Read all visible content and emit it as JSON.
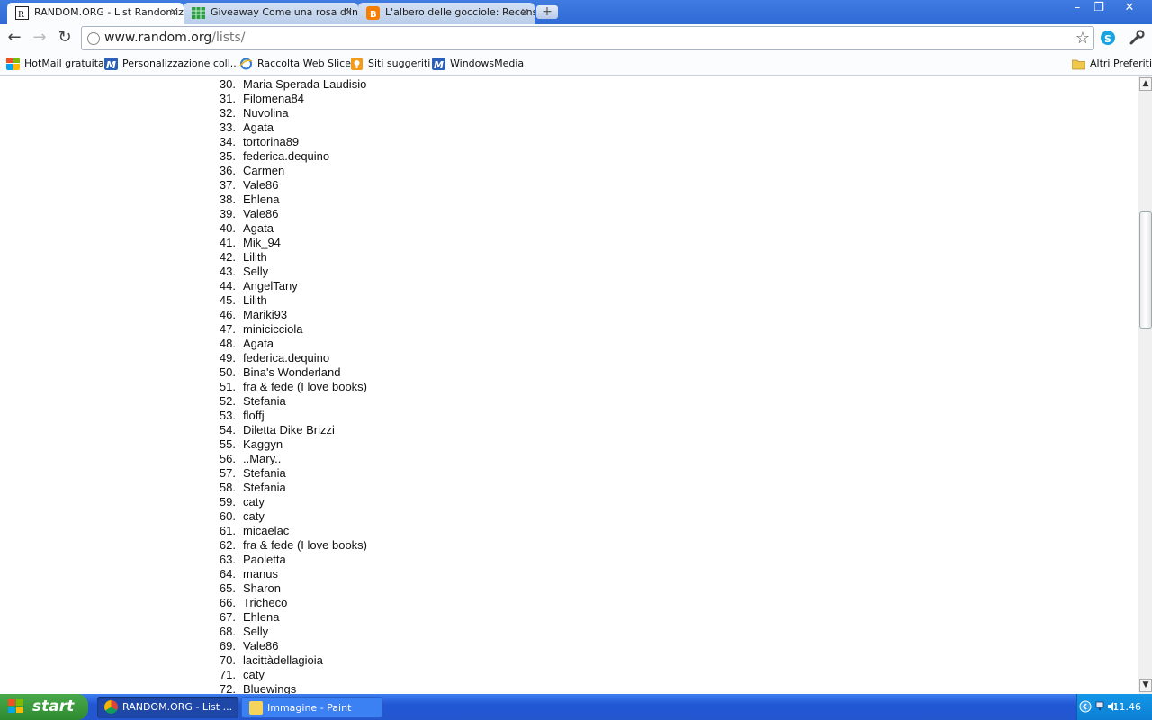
{
  "browser": {
    "tabs": [
      {
        "title": "RANDOM.ORG - List Randomiz",
        "active": true
      },
      {
        "title": "Giveaway Come una rosa d'inv",
        "active": false
      },
      {
        "title": "L'albero delle gocciole: Recens",
        "active": false
      }
    ],
    "url_host": "www.random.org",
    "url_path": "/lists/",
    "bookmarks": [
      {
        "label": "HotMail gratuita"
      },
      {
        "label": "Personalizzazione coll..."
      },
      {
        "label": "Raccolta Web Slice"
      },
      {
        "label": "Siti suggeriti"
      },
      {
        "label": "WindowsMedia"
      },
      {
        "label": "Altri Preferiti"
      }
    ]
  },
  "list": [
    {
      "n": "30.",
      "name": "Maria Sperada Laudisio"
    },
    {
      "n": "31.",
      "name": "Filomena84"
    },
    {
      "n": "32.",
      "name": "Nuvolina"
    },
    {
      "n": "33.",
      "name": "Agata"
    },
    {
      "n": "34.",
      "name": "tortorina89"
    },
    {
      "n": "35.",
      "name": "federica.dequino"
    },
    {
      "n": "36.",
      "name": "Carmen"
    },
    {
      "n": "37.",
      "name": "Vale86"
    },
    {
      "n": "38.",
      "name": "Ehlena"
    },
    {
      "n": "39.",
      "name": "Vale86"
    },
    {
      "n": "40.",
      "name": "Agata"
    },
    {
      "n": "41.",
      "name": "Mik_94"
    },
    {
      "n": "42.",
      "name": "Lilith"
    },
    {
      "n": "43.",
      "name": "Selly"
    },
    {
      "n": "44.",
      "name": "AngelTany"
    },
    {
      "n": "45.",
      "name": "Lilith"
    },
    {
      "n": "46.",
      "name": "Mariki93"
    },
    {
      "n": "47.",
      "name": "minicicciola"
    },
    {
      "n": "48.",
      "name": "Agata"
    },
    {
      "n": "49.",
      "name": "federica.dequino"
    },
    {
      "n": "50.",
      "name": "Bina's Wonderland"
    },
    {
      "n": "51.",
      "name": "fra & fede (I love books)"
    },
    {
      "n": "52.",
      "name": "Stefania"
    },
    {
      "n": "53.",
      "name": "floffj"
    },
    {
      "n": "54.",
      "name": "Diletta Dike Brizzi"
    },
    {
      "n": "55.",
      "name": "Kaggyn"
    },
    {
      "n": "56.",
      "name": "..Mary.."
    },
    {
      "n": "57.",
      "name": "Stefania"
    },
    {
      "n": "58.",
      "name": "Stefania"
    },
    {
      "n": "59.",
      "name": "caty"
    },
    {
      "n": "60.",
      "name": "caty"
    },
    {
      "n": "61.",
      "name": "micaelac"
    },
    {
      "n": "62.",
      "name": "fra & fede (I love books)"
    },
    {
      "n": "63.",
      "name": "Paoletta"
    },
    {
      "n": "64.",
      "name": "manus"
    },
    {
      "n": "65.",
      "name": "Sharon"
    },
    {
      "n": "66.",
      "name": "Tricheco"
    },
    {
      "n": "67.",
      "name": "Ehlena"
    },
    {
      "n": "68.",
      "name": "Selly"
    },
    {
      "n": "69.",
      "name": "Vale86"
    },
    {
      "n": "70.",
      "name": "lacittàdellagioia"
    },
    {
      "n": "71.",
      "name": "caty"
    },
    {
      "n": "72.",
      "name": "Bluewings"
    }
  ],
  "taskbar": {
    "start_label": "start",
    "items": [
      {
        "label": "RANDOM.ORG - List ...",
        "active": true
      },
      {
        "label": "Immagine - Paint",
        "active": false
      }
    ],
    "clock": "11.46"
  },
  "colors": {
    "taskbar_blue": "#2456cf",
    "start_green": "#3a9a3a",
    "tab_strip_blue": "#3a76dd"
  }
}
